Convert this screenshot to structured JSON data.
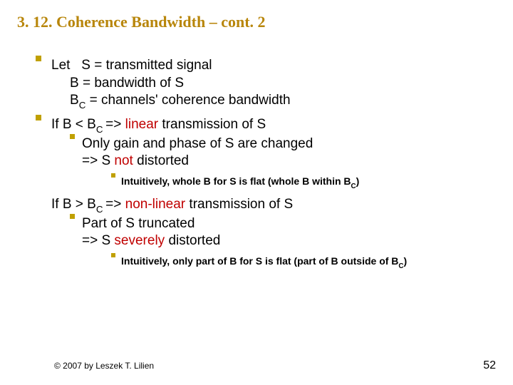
{
  "title": "3. 12. Coherence Bandwidth – cont. 2",
  "let": {
    "lead": "Let",
    "s": "S = transmitted signal",
    "b": "B = bandwidth of S",
    "bc_pre": "B",
    "bc_sub": "C",
    "bc_post": " = channels' coherence bandwidth"
  },
  "linear": {
    "line_pre": "If B < B",
    "line_sub": "C ",
    "line_mid": "=> ",
    "line_red": "linear",
    "line_post": " transmission of S",
    "sub1": "Only gain and phase of S are changed",
    "sub1b_pre": "=> S ",
    "sub1b_red": "not",
    "sub1b_post": " distorted",
    "note_pre": "Intuitively, whole B for S is flat (whole B within B",
    "note_sub": "C",
    "note_post": ")"
  },
  "nonlinear": {
    "line_pre": "If B > B",
    "line_sub": "C ",
    "line_mid": "=> ",
    "line_red": "non-linear",
    "line_post": " transmission of S",
    "sub1": "Part of S truncated",
    "sub1b_pre": "=> S ",
    "sub1b_red": "severely",
    "sub1b_post": " distorted",
    "note_pre": "Intuitively, only part of B for S is flat (part of B outside of B",
    "note_sub": "C",
    "note_post": ")"
  },
  "footer": {
    "copyright": "© 2007 by Leszek T. Lilien",
    "page": "52"
  }
}
